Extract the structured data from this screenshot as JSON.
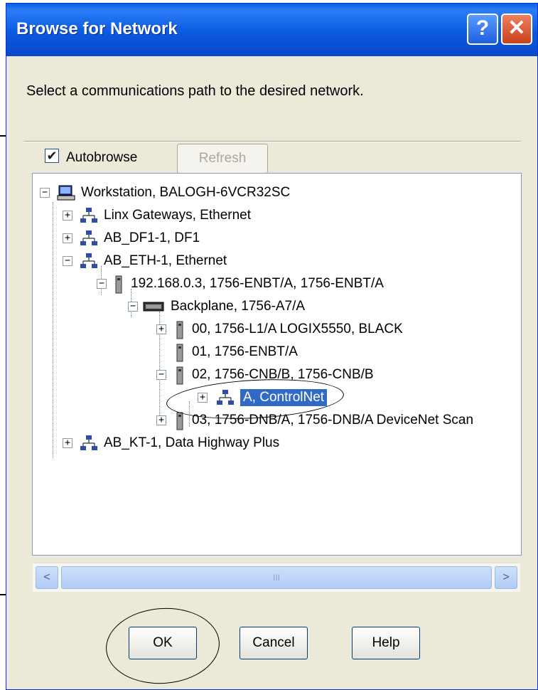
{
  "window": {
    "title": "Browse for Network",
    "help_glyph": "?",
    "close_glyph": "✕"
  },
  "instruction": "Select a communications path to the desired network.",
  "autobrowse": {
    "label": "Autobrowse",
    "checked": true
  },
  "refresh_label": "Refresh",
  "tree": [
    {
      "label": "Workstation, BALOGH-6VCR32SC",
      "icon": "computer-icon",
      "expander": "−"
    },
    {
      "label": "Linx Gateways, Ethernet",
      "icon": "network-icon",
      "expander": "+"
    },
    {
      "label": "AB_DF1-1, DF1",
      "icon": "network-icon",
      "expander": "+"
    },
    {
      "label": "AB_ETH-1, Ethernet",
      "icon": "network-icon",
      "expander": "−"
    },
    {
      "label": "192.168.0.3, 1756-ENBT/A, 1756-ENBT/A",
      "icon": "module-icon",
      "expander": "−"
    },
    {
      "label": "Backplane, 1756-A7/A",
      "icon": "backplane-icon",
      "expander": "−"
    },
    {
      "label": "00, 1756-L1/A LOGIX5550, BLACK",
      "icon": "module-icon",
      "expander": "+"
    },
    {
      "label": "01, 1756-ENBT/A",
      "icon": "module-icon",
      "expander": ""
    },
    {
      "label": "02, 1756-CNB/B, 1756-CNB/B",
      "icon": "module-icon",
      "expander": "−"
    },
    {
      "label": "A, ControlNet",
      "icon": "network-icon",
      "expander": "+",
      "selected": true
    },
    {
      "label": "03, 1756-DNB/A, 1756-DNB/A DeviceNet Scan",
      "icon": "module-icon",
      "expander": "+"
    },
    {
      "label": "AB_KT-1, Data Highway Plus",
      "icon": "network-icon",
      "expander": "+"
    }
  ],
  "scrollbar": {
    "left_arrow": "<",
    "right_arrow": ">",
    "grip": "III"
  },
  "buttons": {
    "ok": "OK",
    "cancel": "Cancel",
    "help": "Help"
  },
  "colors": {
    "title_bar": "#0a5ae0",
    "selection": "#316ac5",
    "dialog_bg": "#ece9d8"
  }
}
